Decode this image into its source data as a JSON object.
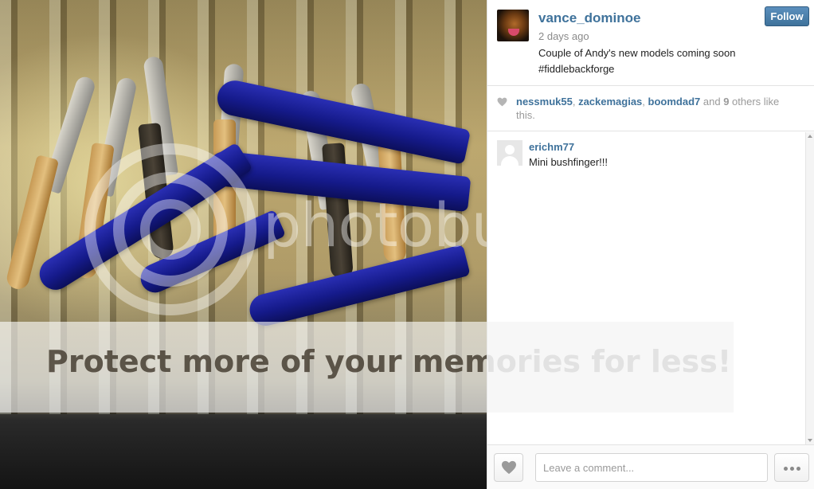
{
  "photo": {
    "watermark_text": "photobucket",
    "banner_text": "Protect more of your memories for less!"
  },
  "post": {
    "username": "vance_dominoe",
    "time": "2 days ago",
    "caption_line1": "Couple of Andy's new models coming soon",
    "caption_line2": "#fiddlebackforge",
    "follow_label": "Follow"
  },
  "likes": {
    "users": [
      "nessmuk55",
      "zackemagias",
      "boomdad7"
    ],
    "sep1": ", ",
    "sep2": ", ",
    "and_text": " and ",
    "others_count": "9",
    "others_text": " others like",
    "tail": "this."
  },
  "comments": [
    {
      "user": "erichm77",
      "text": "Mini bushfinger!!!"
    }
  ],
  "footer": {
    "comment_placeholder": "Leave a comment..."
  },
  "colors": {
    "link_blue": "#3f729b",
    "follow_blue": "#3f729b",
    "muted_gray": "#9a9a9a"
  },
  "icons": {
    "like_button": "heart-icon",
    "more_button": "ellipsis-icon",
    "likes_indicator": "heart-icon"
  }
}
